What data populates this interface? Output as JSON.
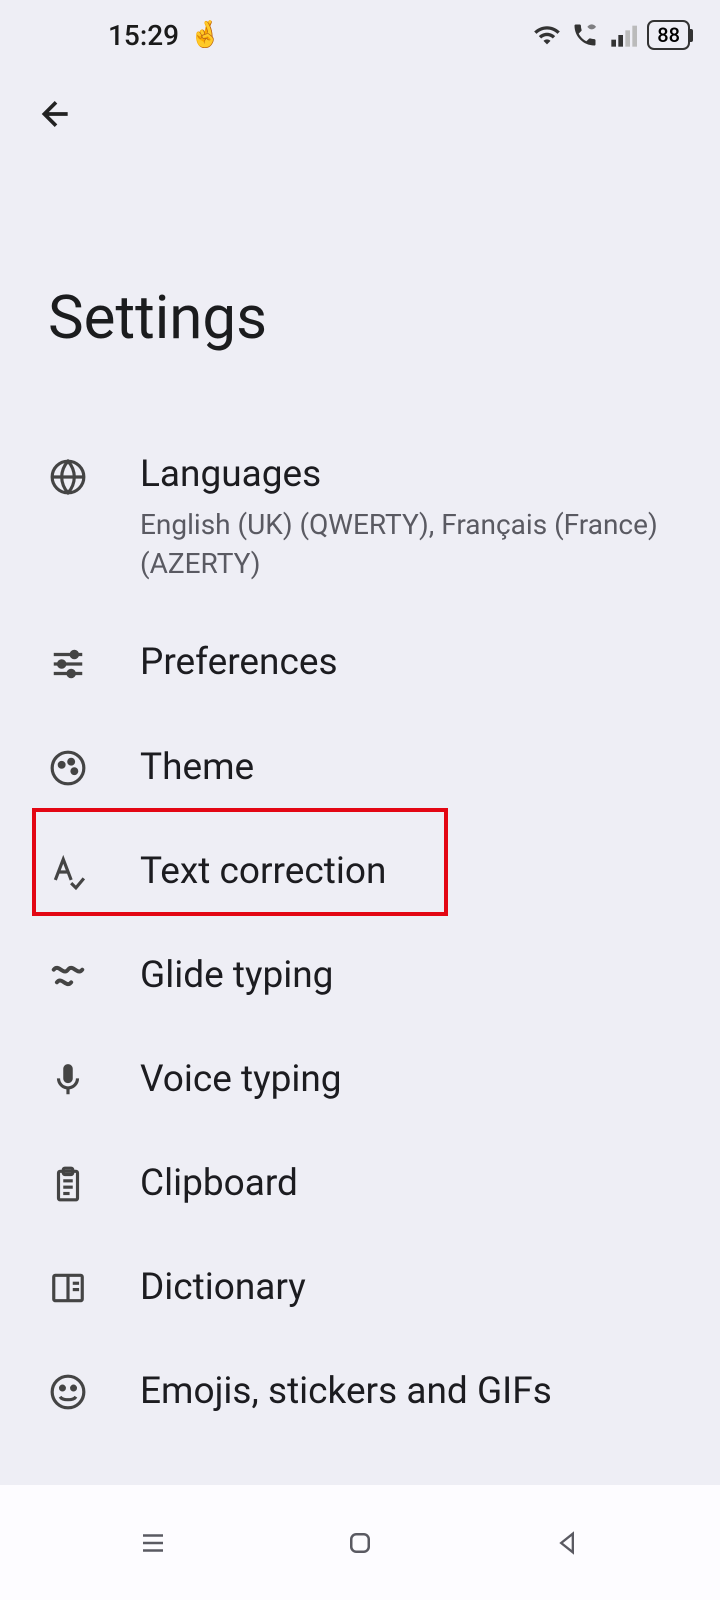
{
  "status": {
    "time": "15:29",
    "battery": "88"
  },
  "title": "Settings",
  "items": [
    {
      "title": "Languages",
      "subtitle": "English (UK) (QWERTY), Français (France) (AZERTY)"
    },
    {
      "title": "Preferences"
    },
    {
      "title": "Theme"
    },
    {
      "title": "Text correction"
    },
    {
      "title": "Glide typing"
    },
    {
      "title": "Voice typing"
    },
    {
      "title": "Clipboard"
    },
    {
      "title": "Dictionary"
    },
    {
      "title": "Emojis, stickers and GIFs"
    }
  ]
}
